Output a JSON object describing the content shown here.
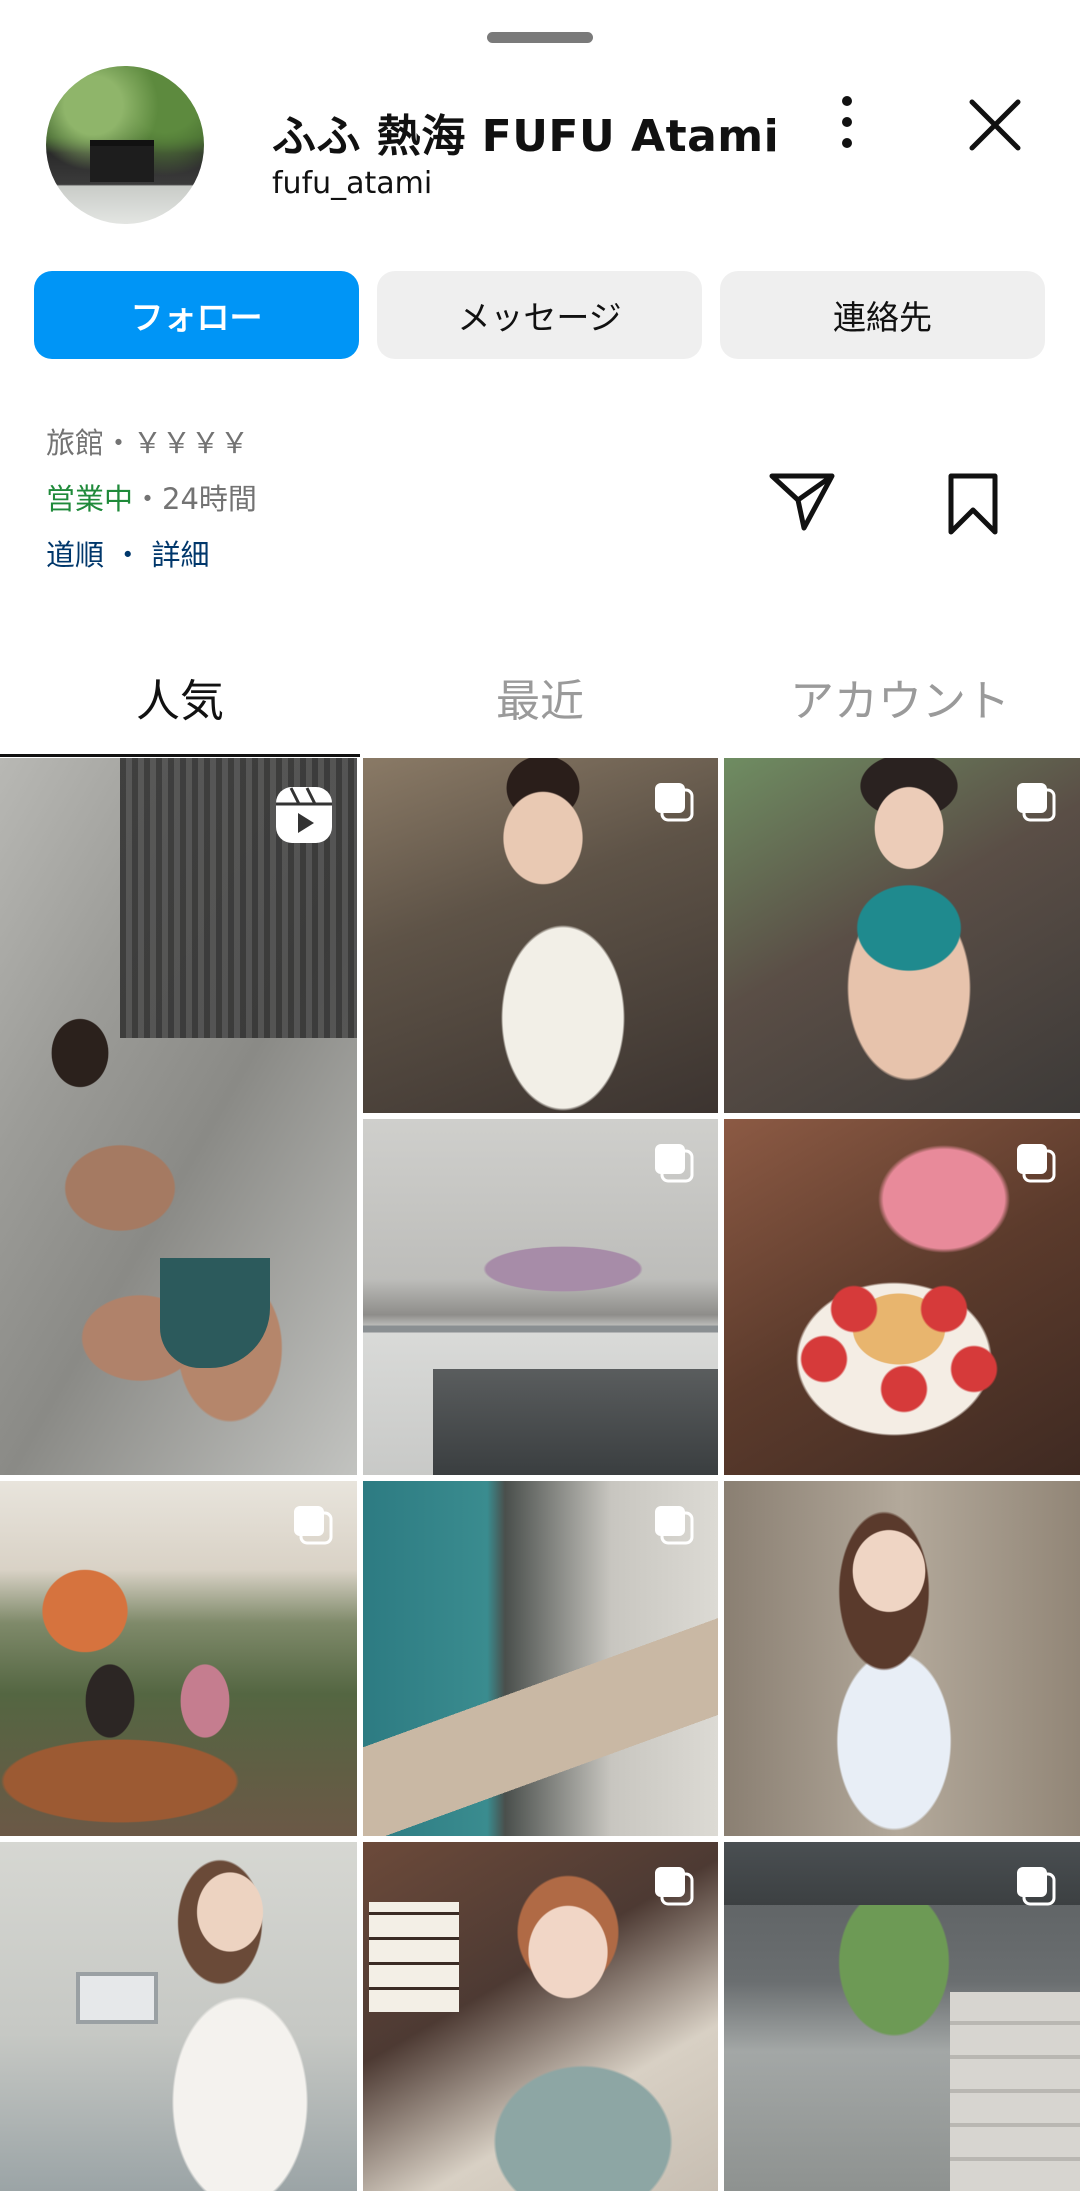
{
  "profile": {
    "title": "ふふ 熱海  FUFU Atami",
    "username": "fufu_atami"
  },
  "header_icons": {
    "more": "more-vertical-icon",
    "close": "close-icon"
  },
  "actions": {
    "follow": "フォロー",
    "message": "メッセージ",
    "contact": "連絡先"
  },
  "info": {
    "category": "旅館・￥￥￥￥",
    "open_status": "営業中",
    "hours": "・24時間",
    "directions": "道順",
    "separator": " ・ ",
    "details": "詳細"
  },
  "tabs": {
    "popular": "人気",
    "recent": "最近",
    "account": "アカウント",
    "active": "popular"
  },
  "colors": {
    "accent": "#0095f6",
    "open_green": "#1f8a3a",
    "link_blue": "#00376b"
  },
  "grid": [
    {
      "type": "reel"
    },
    {
      "type": "carousel"
    },
    {
      "type": "carousel"
    },
    {
      "type": "carousel"
    },
    {
      "type": "carousel"
    },
    {
      "type": "carousel"
    },
    {
      "type": "carousel"
    },
    {
      "type": "single"
    },
    {
      "type": "single"
    },
    {
      "type": "carousel"
    },
    {
      "type": "carousel"
    }
  ]
}
